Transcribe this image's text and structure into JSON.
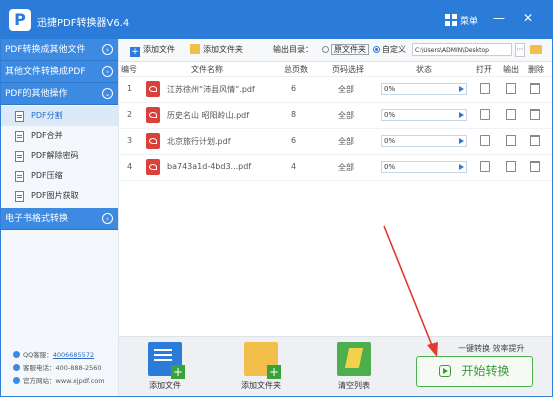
{
  "app": {
    "title": "迅捷PDF转换器V6.4",
    "menu_label": "菜单"
  },
  "sidebar": {
    "nav": [
      {
        "label": "PDF转换成其他文件"
      },
      {
        "label": "其他文件转换成PDF"
      },
      {
        "label": "PDF的其他操作"
      },
      {
        "label": "电子书格式转换"
      }
    ],
    "subitems": [
      {
        "label": "PDF分割"
      },
      {
        "label": "PDF合并"
      },
      {
        "label": "PDF解除密码"
      },
      {
        "label": "PDF压缩"
      },
      {
        "label": "PDF图片获取"
      }
    ],
    "contact": {
      "qq_label": "QQ客服：",
      "qq_value": "4006685572",
      "phone_label": "客服电话：",
      "phone_value": "400-888-2560",
      "site_label": "官方网站：",
      "site_value": "www.xjpdf.com"
    }
  },
  "toolbar": {
    "add_file": "添加文件",
    "add_folder": "添加文件夹",
    "output_dir_label": "输出目录：",
    "original_folder": "原文件夹",
    "custom": "自定义",
    "custom_path": "C:\\Users\\ADMIN\\Desktop"
  },
  "table": {
    "headers": {
      "no": "编号",
      "name": "文件名称",
      "pages": "总页数",
      "select": "页码选择",
      "status": "状态",
      "open": "打开",
      "output": "输出",
      "delete": "删除"
    },
    "rows": [
      {
        "no": "1",
        "name": "江苏徐州“沛县风情”.pdf",
        "pages": "6",
        "select": "全部",
        "progress": "0%"
      },
      {
        "no": "2",
        "name": "历史名山 昭阳岭山.pdf",
        "pages": "8",
        "select": "全部",
        "progress": "0%"
      },
      {
        "no": "3",
        "name": "北京旅行计划.pdf",
        "pages": "6",
        "select": "全部",
        "progress": "0%"
      },
      {
        "no": "4",
        "name": "ba743a1d-4bd3...pdf",
        "pages": "4",
        "select": "全部",
        "progress": "0%"
      }
    ]
  },
  "bottom": {
    "add_file": "添加文件",
    "add_folder": "添加文件夹",
    "clear_list": "清空列表",
    "slogan": "一键转换  效率提升",
    "start": "开始转换"
  },
  "colors": {
    "brand": "#2b7cd9",
    "start_green": "#3c9a3c",
    "arrow_red": "#e23a2e"
  }
}
